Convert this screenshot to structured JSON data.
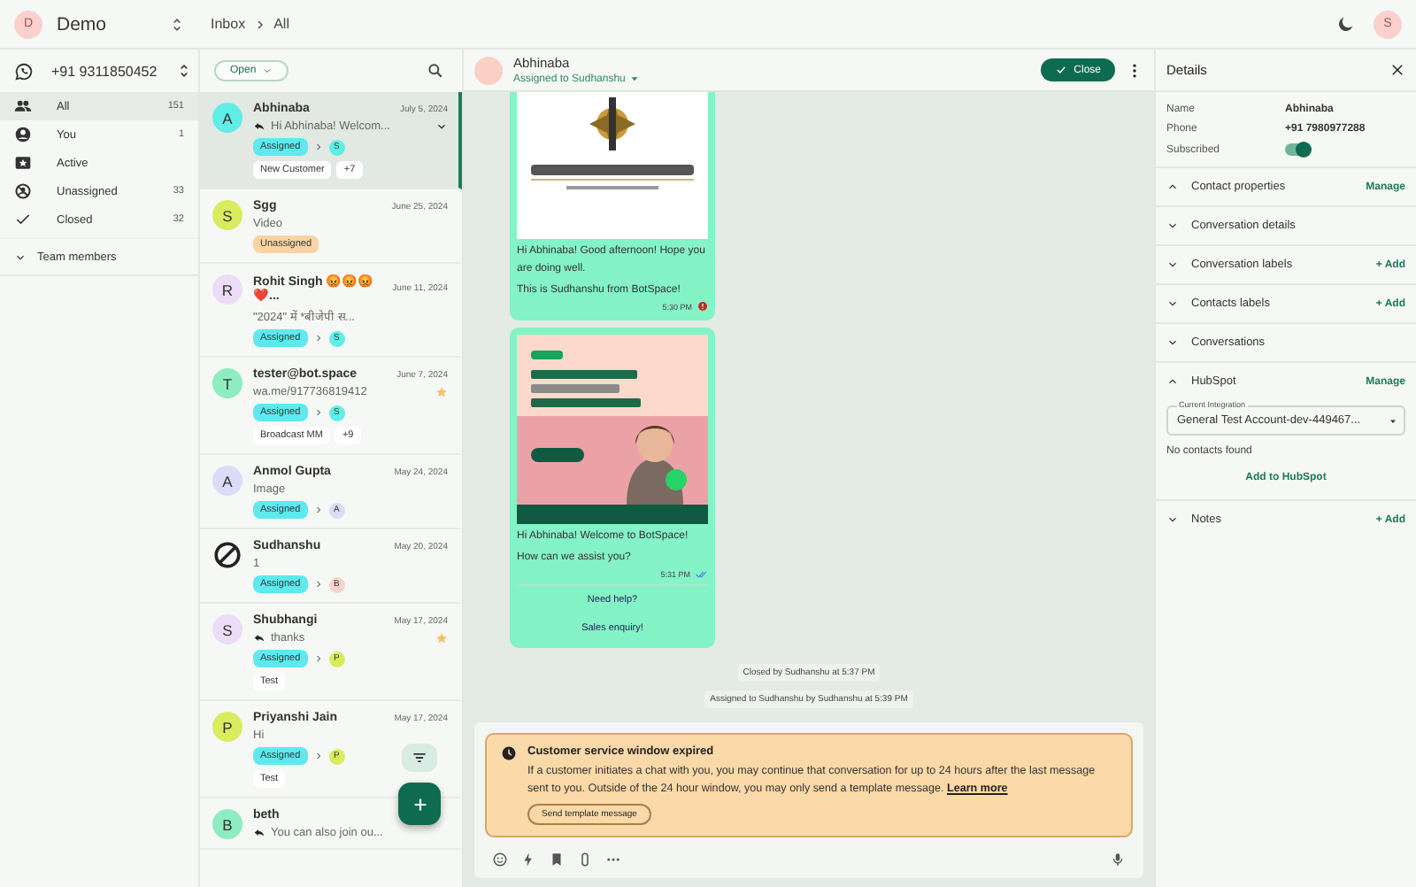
{
  "workspace": {
    "avatar": "D",
    "name": "Demo"
  },
  "breadcrumb": [
    "Inbox",
    "All"
  ],
  "user_avatar": "S",
  "channel": {
    "phone": "+91 9311850452"
  },
  "nav": [
    {
      "kind": "all",
      "label": "All",
      "count": "151",
      "selected": true
    },
    {
      "kind": "you",
      "label": "You",
      "count": "1",
      "selected": false
    },
    {
      "kind": "active",
      "label": "Active",
      "selected": false
    },
    {
      "kind": "unassigned",
      "label": "Unassigned",
      "count": "33",
      "selected": false
    },
    {
      "kind": "closed",
      "label": "Closed",
      "count": "32",
      "selected": false
    }
  ],
  "team_members": {
    "label": "Team members",
    "expanded": false
  },
  "filter": {
    "label": "Open"
  },
  "conversations": [
    {
      "avatar": {
        "kind": "letter",
        "initial": "A",
        "color": "#5eeee6"
      },
      "name": "Abhinaba",
      "date": "July 5, 2024",
      "preview": "Hi Abhinaba! Welcom...",
      "replied": true,
      "dropdown": true,
      "starred": false,
      "status": {
        "label": "Assigned",
        "color": "#5ee9ef"
      },
      "agent": {
        "initial": "S",
        "color": "#5eeee6"
      },
      "labels": [
        "New Customer",
        "+7"
      ],
      "selected": true
    },
    {
      "avatar": {
        "kind": "letter",
        "initial": "S",
        "color": "#d9ec5e"
      },
      "name": "Sgg",
      "date": "June 25, 2024",
      "preview": "Video",
      "replied": false,
      "dropdown": false,
      "starred": false,
      "status": {
        "label": "Unassigned",
        "color": "#fbd3a3"
      },
      "selected": false
    },
    {
      "avatar": {
        "kind": "letter",
        "initial": "R",
        "color": "#ecdcf7"
      },
      "name": "Rohit Singh 😡😡😡❤️...",
      "date": "June 11, 2024",
      "preview": "\"2024\" में *बीजेपी स...",
      "replied": false,
      "dropdown": false,
      "starred": false,
      "status": {
        "label": "Assigned",
        "color": "#5ee9ef"
      },
      "agent": {
        "initial": "S",
        "color": "#5eeee6"
      },
      "selected": false
    },
    {
      "avatar": {
        "kind": "letter",
        "initial": "T",
        "color": "#8eedc0"
      },
      "name": "tester@bot.space",
      "date": "June 7, 2024",
      "preview": "wa.me/917736819412",
      "replied": false,
      "dropdown": false,
      "starred": true,
      "status": {
        "label": "Assigned",
        "color": "#5ee9ef"
      },
      "agent": {
        "initial": "S",
        "color": "#5eeee6"
      },
      "labels": [
        "Broadcast MM",
        "+9"
      ],
      "selected": false
    },
    {
      "avatar": {
        "kind": "letter",
        "initial": "A",
        "color": "#dcdcf9"
      },
      "name": "Anmol Gupta",
      "date": "May 24, 2024",
      "preview": "Image",
      "replied": false,
      "dropdown": false,
      "starred": false,
      "status": {
        "label": "Assigned",
        "color": "#5ee9ef"
      },
      "agent": {
        "initial": "A",
        "color": "#dcdcf9"
      },
      "selected": false
    },
    {
      "avatar": {
        "kind": "blocked"
      },
      "name": "Sudhanshu",
      "date": "May 20, 2024",
      "preview": "1",
      "replied": false,
      "dropdown": false,
      "starred": false,
      "status": {
        "label": "Assigned",
        "color": "#5ee9ef"
      },
      "agent": {
        "initial": "B",
        "color": "#fbd3cc"
      },
      "selected": false
    },
    {
      "avatar": {
        "kind": "letter",
        "initial": "S",
        "color": "#ecdcf7"
      },
      "name": "Shubhangi",
      "date": "May 17, 2024",
      "preview": "thanks",
      "replied": true,
      "dropdown": false,
      "starred": true,
      "status": {
        "label": "Assigned",
        "color": "#5ee9ef"
      },
      "agent": {
        "initial": "P",
        "color": "#d9ec5e"
      },
      "labels": [
        "Test"
      ],
      "selected": false
    },
    {
      "avatar": {
        "kind": "letter",
        "initial": "P",
        "color": "#d9ec5e"
      },
      "name": "Priyanshi Jain",
      "date": "May 17, 2024",
      "preview": "Hi",
      "replied": false,
      "dropdown": false,
      "starred": false,
      "status": {
        "label": "Assigned",
        "color": "#5ee9ef"
      },
      "agent": {
        "initial": "P",
        "color": "#d9ec5e"
      },
      "labels": [
        "Test"
      ],
      "selected": false
    },
    {
      "avatar": {
        "kind": "letter",
        "initial": "B",
        "color": "#8eedc0"
      },
      "name": "beth",
      "preview": "You can also join ou...",
      "replied": true,
      "dropdown": false,
      "starred": false,
      "selected": false
    }
  ],
  "chat": {
    "name": "Abhinaba",
    "assignment": "Assigned to Sudhanshu",
    "close_button": "Close"
  },
  "messages": [
    {
      "kind": "picture",
      "lines": [
        "Hi Abhinaba! Good afternoon! Hope you are doing well.",
        "This is Sudhanshu from BotSpace!"
      ],
      "time": "5:30 PM",
      "receipt": {
        "kind": "failed"
      }
    },
    {
      "kind": "picture",
      "lines": [
        "Hi Abhinaba! Welcome to BotSpace!",
        "How can we assist you?"
      ],
      "time": "5:31 PM",
      "receipt": {
        "kind": "read"
      },
      "quick_replies": [
        "Need help?",
        "Sales enquiry!"
      ]
    }
  ],
  "events": [
    "Closed by Sudhanshu at 5:37 PM",
    "Assigned to Sudhanshu by Sudhanshu at 5:39 PM"
  ],
  "notice": {
    "title": "Customer service window expired",
    "body": "If a customer initiates a chat with you, you may continue that conversation for up to 24 hours after the last message sent to you. Outside of the 24 hour window, you may only send a template message.",
    "link": "Learn more",
    "button": "Send template message"
  },
  "details": {
    "title": "Details",
    "fields": [
      {
        "label": "Name",
        "value": "Abhinaba"
      },
      {
        "label": "Phone",
        "value": "+91 7980977288"
      }
    ],
    "subscribed": {
      "label": "Subscribed",
      "on": true
    },
    "sections": [
      {
        "title": "Contact properties",
        "expanded": true,
        "action": "Manage"
      },
      {
        "title": "Conversation details",
        "expanded": false
      },
      {
        "title": "Conversation labels",
        "expanded": false,
        "action": "+ Add"
      },
      {
        "title": "Contacts labels",
        "expanded": false,
        "action": "+ Add"
      },
      {
        "title": "Conversations",
        "expanded": false
      },
      {
        "title": "HubSpot",
        "expanded": true,
        "action": "Manage",
        "integration_label": "Current Integration",
        "integration_value": "General Test Account-dev-449467...",
        "empty_text": "No contacts found",
        "add_button": "Add to HubSpot"
      },
      {
        "title": "Notes",
        "expanded": false,
        "action": "+ Add"
      }
    ]
  }
}
